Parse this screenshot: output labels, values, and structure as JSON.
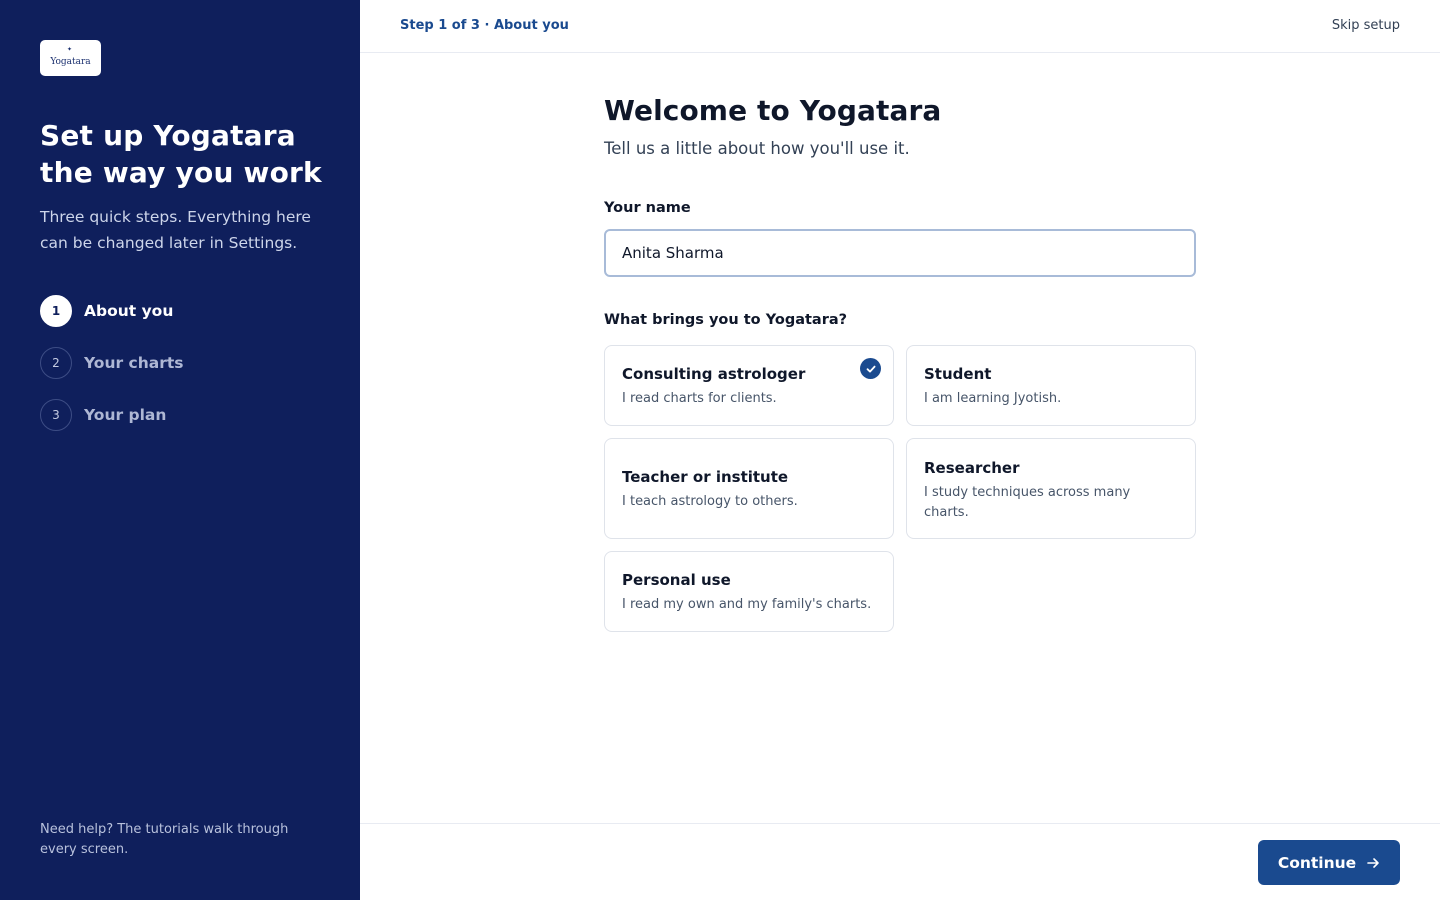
{
  "brand": {
    "logo_text": "Yogatara"
  },
  "sidebar": {
    "headline": "Set up Yogatara the way you work",
    "subline": "Three quick steps. Everything here can be changed later in Settings.",
    "steps": [
      {
        "num": "1",
        "label": "About you",
        "active": true
      },
      {
        "num": "2",
        "label": "Your charts",
        "active": false
      },
      {
        "num": "3",
        "label": "Your plan",
        "active": false
      }
    ],
    "help": "Need help? The tutorials walk through every screen."
  },
  "topbar": {
    "progress": "Step 1 of 3 · About you",
    "skip_label": "Skip setup"
  },
  "main": {
    "title": "Welcome to Yogatara",
    "subtitle": "Tell us a little about how you'll use it.",
    "name_label": "Your name",
    "name_value": "Anita Sharma",
    "question": "What brings you to Yogatara?",
    "options": [
      {
        "title": "Consulting astrologer",
        "desc": "I read charts for clients.",
        "selected": true
      },
      {
        "title": "Student",
        "desc": "I am learning Jyotish.",
        "selected": false
      },
      {
        "title": "Teacher or institute",
        "desc": "I teach astrology to others.",
        "selected": false
      },
      {
        "title": "Researcher",
        "desc": "I study techniques across many charts.",
        "selected": false
      },
      {
        "title": "Personal use",
        "desc": "I read my own and my family's charts.",
        "selected": false
      }
    ]
  },
  "footer": {
    "continue_label": "Continue"
  },
  "colors": {
    "sidebar_bg": "#0f1f5c",
    "accent": "#1a4a8f"
  }
}
